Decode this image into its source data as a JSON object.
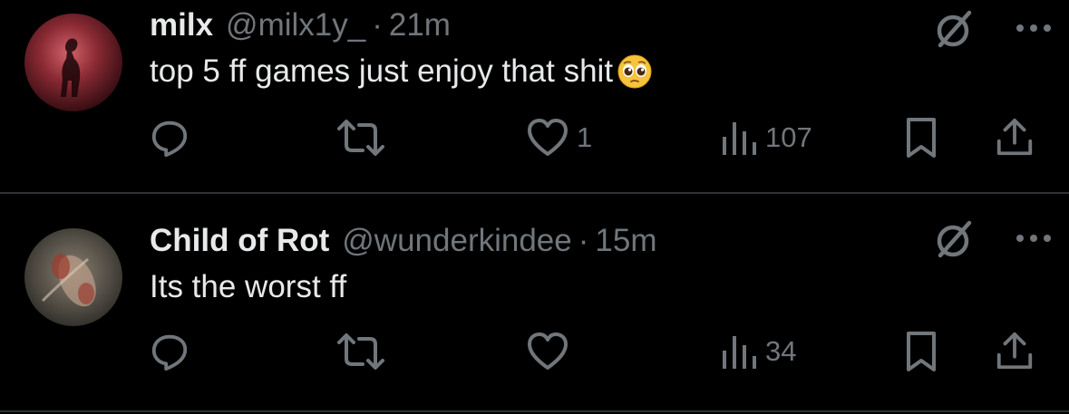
{
  "tweets": [
    {
      "display_name": "milx",
      "handle": "@milx1y_",
      "separator": "·",
      "time": "21m",
      "text": "top 5 ff games just enjoy that shit",
      "emoji": "pleading-face-emoji",
      "replies": "",
      "retweets": "",
      "likes": "1",
      "views": "107"
    },
    {
      "display_name": "Child of Rot",
      "handle": "@wunderkindee",
      "separator": "·",
      "time": "15m",
      "text": "Its the worst ff",
      "replies": "",
      "retweets": "",
      "likes": "",
      "views": "34"
    }
  ],
  "icons": {
    "reply": "reply-icon",
    "retweet": "retweet-icon",
    "like": "heart-icon",
    "views": "views-bar-chart-icon",
    "bookmark": "bookmark-icon",
    "share": "share-icon",
    "grok": "grok-icon",
    "more": "more-dots-icon"
  },
  "colors": {
    "background": "#000000",
    "text_primary": "#e7e9ea",
    "text_secondary": "#71767b",
    "divider": "#2f3336"
  }
}
